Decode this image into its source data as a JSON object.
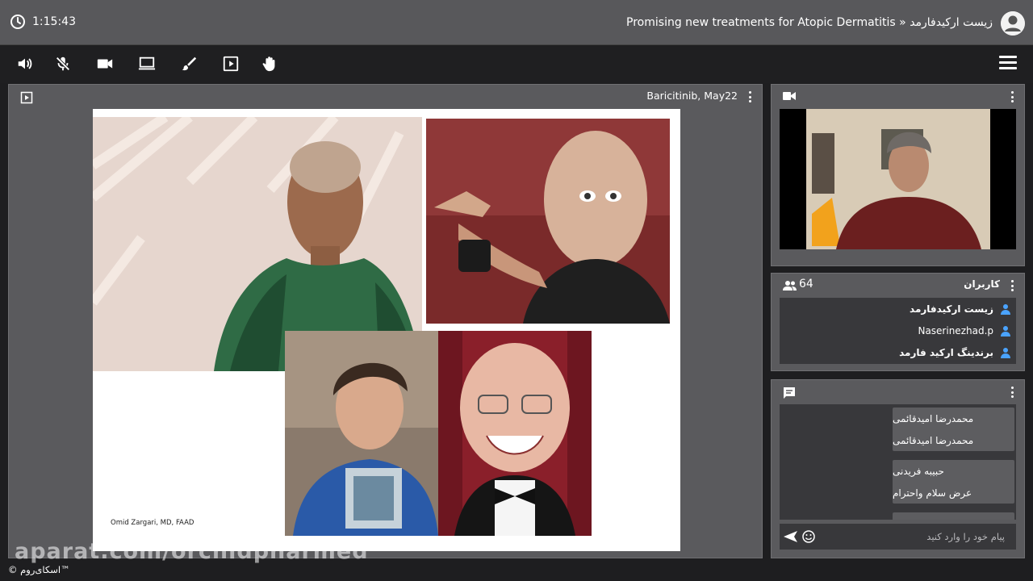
{
  "titlebar": {
    "elapsed": "1:15:43",
    "title": "Promising new treatments for Atopic Dermatitis » زیست ارکیدفارمد"
  },
  "toolbar": {
    "tools": [
      "speaker-icon",
      "mic-off-icon",
      "camera-icon",
      "screen-share-icon",
      "brush-icon",
      "presentation-icon",
      "raise-hand-icon"
    ],
    "menu": "menu-icon"
  },
  "presentation": {
    "title": "Baricitinib, May22",
    "slide": {
      "author": "Omid Zargari, MD, FAAD"
    }
  },
  "users": {
    "label": "کاربران",
    "count": "64",
    "items": [
      {
        "name": "زیست ارکیدفارمد"
      },
      {
        "name": "Naserinezhad.p"
      },
      {
        "name": "برندینگ ارکید فارمد"
      }
    ]
  },
  "chat": {
    "messages": [
      {
        "lines": [
          "محمدرضا امیدقائمی",
          "محمدرضا امیدقائمی"
        ]
      },
      {
        "lines": [
          "حبیبه فریدنی",
          "عرض سلام واحترام"
        ]
      }
    ],
    "placeholder": "پیام خود را وارد کنید"
  },
  "overlay": {
    "watermark": "aparat.com/orchidpharmed",
    "brand": "© اسکای‌روم™"
  },
  "colors": {
    "titlebar": "#58585b",
    "panel": "#5a5a5d",
    "toolbar": "#1f1f21",
    "user_icon": "#4aa3ff"
  }
}
